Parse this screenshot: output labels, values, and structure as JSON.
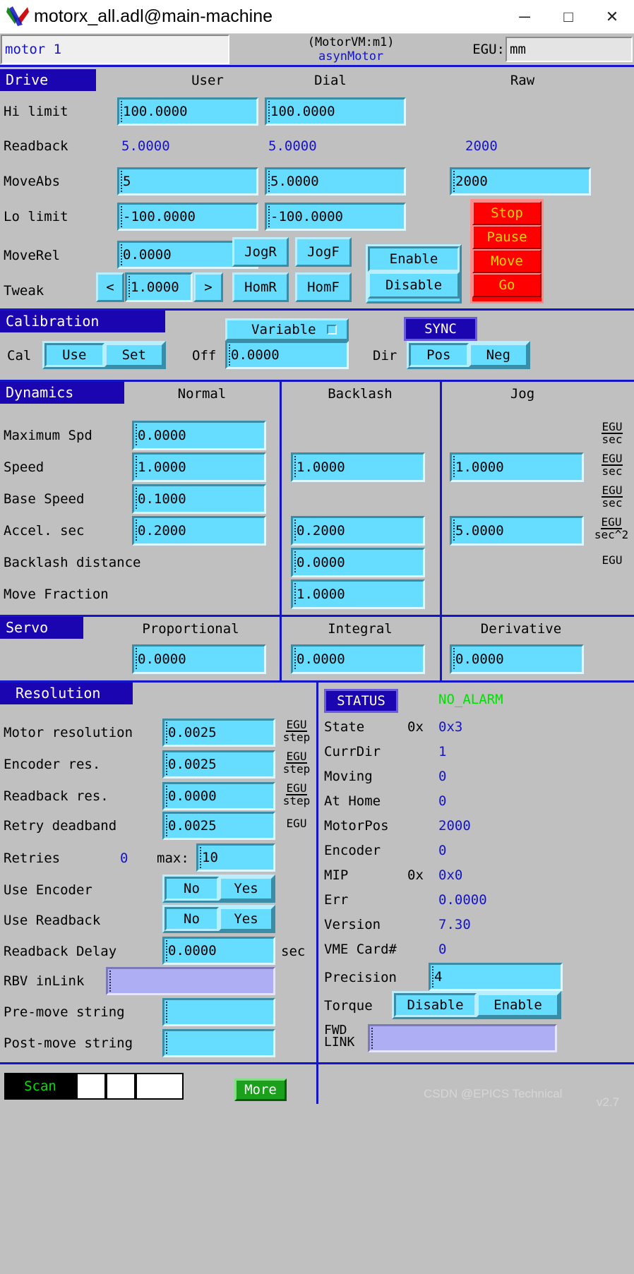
{
  "window": {
    "title": "motorx_all.adl@main-machine",
    "minimize": "─",
    "maximize": "□",
    "close": "✕"
  },
  "header": {
    "description": "motor 1",
    "pv_line1": "(MotorVM:m1)",
    "pv_line2": "asynMotor",
    "egu_label": "EGU:",
    "egu_value": "mm"
  },
  "drive": {
    "title": "Drive",
    "columns": [
      "User",
      "Dial",
      "Raw"
    ],
    "rows": [
      {
        "label": "Hi limit",
        "user": "100.0000",
        "dial": "100.0000",
        "raw": ""
      },
      {
        "label": "Readback",
        "user": "5.0000",
        "dial": "5.0000",
        "raw": "2000"
      },
      {
        "label": "MoveAbs",
        "user": "5",
        "dial": "5.0000",
        "raw": "2000"
      },
      {
        "label": "Lo limit",
        "user": "-100.0000",
        "dial": "-100.0000",
        "raw": ""
      },
      {
        "label": "MoveRel",
        "user": "0.0000",
        "dial": "",
        "raw": ""
      },
      {
        "label": "Tweak",
        "user": "1.0000",
        "dial": "",
        "raw": ""
      }
    ],
    "tweak_down": "<",
    "tweak_up": ">",
    "jog_rev": "JogR",
    "jog_fwd": "JogF",
    "home_rev": "HomR",
    "home_fwd": "HomF",
    "enable": "Enable",
    "disable": "Disable",
    "red_buttons": [
      "Stop",
      "Pause",
      "Move",
      "Go"
    ]
  },
  "calibration": {
    "title": "Calibration",
    "cal_label": "Cal",
    "cal_use": "Use",
    "cal_set": "Set",
    "off_label": "Off",
    "off_value": "0.0000",
    "set_mode": "Variable",
    "sync": "SYNC",
    "dir_label": "Dir",
    "dir_pos": "Pos",
    "dir_neg": "Neg"
  },
  "dynamics": {
    "title": "Dynamics",
    "columns": [
      "Normal",
      "Backlash",
      "Jog"
    ],
    "rows": [
      {
        "label": "Maximum Spd",
        "normal": "0.0000",
        "backlash": "",
        "jog": "",
        "units_num": "EGU",
        "units_den": "sec"
      },
      {
        "label": "Speed",
        "normal": "1.0000",
        "backlash": "1.0000",
        "jog": "1.0000",
        "units_num": "EGU",
        "units_den": "sec"
      },
      {
        "label": "Base Speed",
        "normal": "0.1000",
        "backlash": "",
        "jog": "",
        "units_num": "EGU",
        "units_den": "sec"
      },
      {
        "label": "Accel. sec",
        "normal": "0.2000",
        "backlash": "0.2000",
        "jog": "5.0000",
        "units_num": "EGU",
        "units_den": "sec^2"
      },
      {
        "label": "Backlash distance",
        "normal": "",
        "backlash": "0.0000",
        "jog": "",
        "units_num": "",
        "units_den": "EGU"
      },
      {
        "label": "Move Fraction",
        "normal": "",
        "backlash": "1.0000",
        "jog": "",
        "units_num": "",
        "units_den": ""
      }
    ]
  },
  "servo": {
    "title": "Servo",
    "columns": [
      "Proportional",
      "Integral",
      "Derivative"
    ],
    "values": [
      "0.0000",
      "0.0000",
      "0.0000"
    ]
  },
  "resolution": {
    "title": "Resolution",
    "rows": [
      {
        "label": "Motor resolution",
        "value": "0.0025",
        "units_num": "EGU",
        "units_den": "step"
      },
      {
        "label": "Encoder res.",
        "value": "0.0025",
        "units_num": "EGU",
        "units_den": "step"
      },
      {
        "label": "Readback res.",
        "value": "0.0000",
        "units_num": "EGU",
        "units_den": "step"
      },
      {
        "label": "Retry deadband",
        "value": "0.0025",
        "units_num": "",
        "units_den": "EGU"
      }
    ],
    "retries_label": "Retries",
    "retries_value": "0",
    "retries_max_label": "max:",
    "retries_max_value": "10",
    "use_encoder_label": "Use Encoder",
    "use_readback_label": "Use Readback",
    "no": "No",
    "yes": "Yes",
    "readback_delay_label": "Readback Delay",
    "readback_delay_value": "0.0000",
    "readback_delay_units": "sec",
    "rbv_inlink_label": "RBV inLink",
    "rbv_inlink_value": "",
    "premove_label": "Pre-move string",
    "premove_value": "",
    "postmove_label": "Post-move string",
    "postmove_value": ""
  },
  "status": {
    "title": "STATUS",
    "alarm": "NO_ALARM",
    "rows": [
      {
        "label": "State",
        "prefix": "0x",
        "value": "0x3"
      },
      {
        "label": "CurrDir",
        "prefix": "",
        "value": "1"
      },
      {
        "label": "Moving",
        "prefix": "",
        "value": "0"
      },
      {
        "label": "At Home",
        "prefix": "",
        "value": "0"
      },
      {
        "label": "MotorPos",
        "prefix": "",
        "value": "2000"
      },
      {
        "label": "Encoder",
        "prefix": "",
        "value": "0"
      },
      {
        "label": "MIP",
        "prefix": "0x",
        "value": "0x0"
      },
      {
        "label": "Err",
        "prefix": "",
        "value": "0.0000"
      },
      {
        "label": "Version",
        "prefix": "",
        "value": "7.30"
      },
      {
        "label": "VME Card#",
        "prefix": "",
        "value": "0"
      }
    ],
    "precision_label": "Precision",
    "precision_value": "4",
    "torque_label": "Torque",
    "torque_disable": "Disable",
    "torque_enable": "Enable",
    "fwdlink_l1": "FWD",
    "fwdlink_l2": "LINK",
    "fwdlink_value": ""
  },
  "footer": {
    "scan_label": "Scan",
    "more_label": "More",
    "field1": "",
    "field2": "",
    "field3": ""
  },
  "watermark": {
    "text": "CSDN @EPICS Technical",
    "version": "v2.7"
  },
  "colors": {
    "accent_blue": "#1414c8",
    "section_header": "#1a05b0",
    "entry_cyan": "#66ddff",
    "alarm_green": "#00e000",
    "red_button": "#ff0000",
    "red_text": "#ffd400"
  }
}
